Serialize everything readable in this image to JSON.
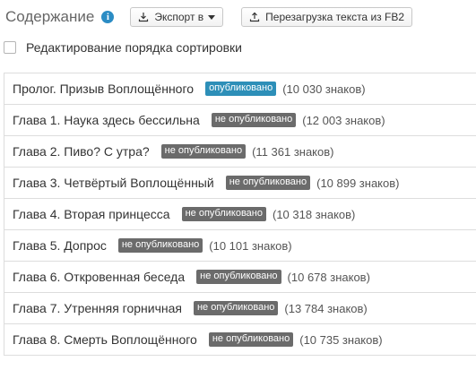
{
  "header": {
    "title": "Содержание",
    "info_icon": "info-icon",
    "export_button": {
      "label": "Экспорт в",
      "icon": "download-icon"
    },
    "reload_button": {
      "label": "Перезагрузка текста из FB2",
      "icon": "upload-icon"
    }
  },
  "reorder": {
    "label": "Редактирование порядка сортировки",
    "checked": false
  },
  "colors": {
    "published": "#2d8fb8",
    "unpublished": "#6b6b6b",
    "info_icon": "#2b8cc4"
  },
  "chapters": [
    {
      "title": "Пролог. Призыв Воплощённого",
      "status": "опубликовано",
      "published": true,
      "chars": "(10 030 знаков)"
    },
    {
      "title": "Глава 1. Наука здесь бессильна",
      "status": "не опубликовано",
      "published": false,
      "chars": "(12 003 знаков)"
    },
    {
      "title": "Глава 2. Пиво? С утра?",
      "status": "не опубликовано",
      "published": false,
      "chars": "(11 361 знаков)"
    },
    {
      "title": "Глава 3. Четвёртый Воплощённый",
      "status": "не опубликовано",
      "published": false,
      "chars": "(10 899 знаков)"
    },
    {
      "title": "Глава 4. Вторая принцесса",
      "status": "не опубликовано",
      "published": false,
      "chars": "(10 318 знаков)"
    },
    {
      "title": "Глава 5. Допрос",
      "status": "не опубликовано",
      "published": false,
      "chars": "(10 101 знаков)"
    },
    {
      "title": "Глава 6. Откровенная беседа",
      "status": "не опубликовано",
      "published": false,
      "chars": "(10 678 знаков)"
    },
    {
      "title": "Глава 7. Утренняя горничная",
      "status": "не опубликовано",
      "published": false,
      "chars": "(13 784 знаков)"
    },
    {
      "title": "Глава 8. Смерть Воплощённого",
      "status": "не опубликовано",
      "published": false,
      "chars": "(10 735 знаков)"
    }
  ]
}
